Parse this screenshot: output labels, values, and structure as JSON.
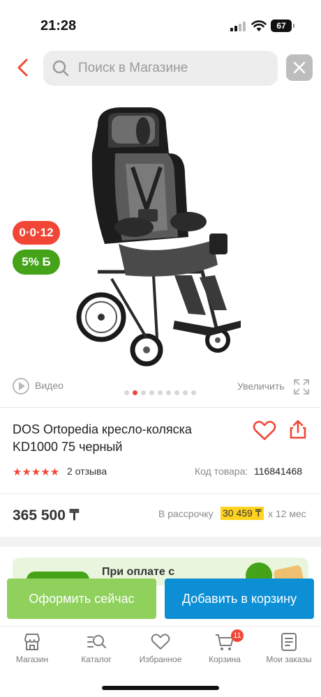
{
  "status_bar": {
    "time": "21:28",
    "battery": "67"
  },
  "header": {
    "search_placeholder": "Поиск в Магазине",
    "icons": [
      "chevron-left-icon",
      "search-icon",
      "close-icon"
    ]
  },
  "gallery": {
    "badge_installment": "0·0·12",
    "badge_bonus": "5% Б",
    "video_label": "Видео",
    "zoom_label": "Увеличить",
    "slide_count": 9,
    "active_slide": 2
  },
  "product": {
    "title": "DOS Ortopedia кресло-коляска KD1000 75 черный",
    "rating_stars": "★★★★★",
    "rating": 5,
    "reviews": "2 отзыва",
    "sku_label": "Код товара:",
    "sku": "116841468",
    "price": "365 500 ₸",
    "installment_label": "В рассрочку",
    "installment_amount": "30 459 ₸",
    "installment_period": "x 12 мес"
  },
  "promo": {
    "text": "При оплате с"
  },
  "actions": {
    "checkout": "Оформить сейчас",
    "add_to_cart": "Добавить в корзину"
  },
  "bottom_nav": {
    "items": [
      {
        "label": "Магазин",
        "icon": "store-icon"
      },
      {
        "label": "Каталог",
        "icon": "catalog-search-icon"
      },
      {
        "label": "Избранное",
        "icon": "heart-icon"
      },
      {
        "label": "Корзина",
        "icon": "cart-icon",
        "badge": "11"
      },
      {
        "label": "Мои заказы",
        "icon": "orders-icon"
      }
    ]
  },
  "colors": {
    "accent_red": "#f14635",
    "bonus_green": "#44a319",
    "checkout_green": "#8fd15c",
    "cart_blue": "#0d8fd6",
    "installment_yellow": "#ffd21f"
  }
}
